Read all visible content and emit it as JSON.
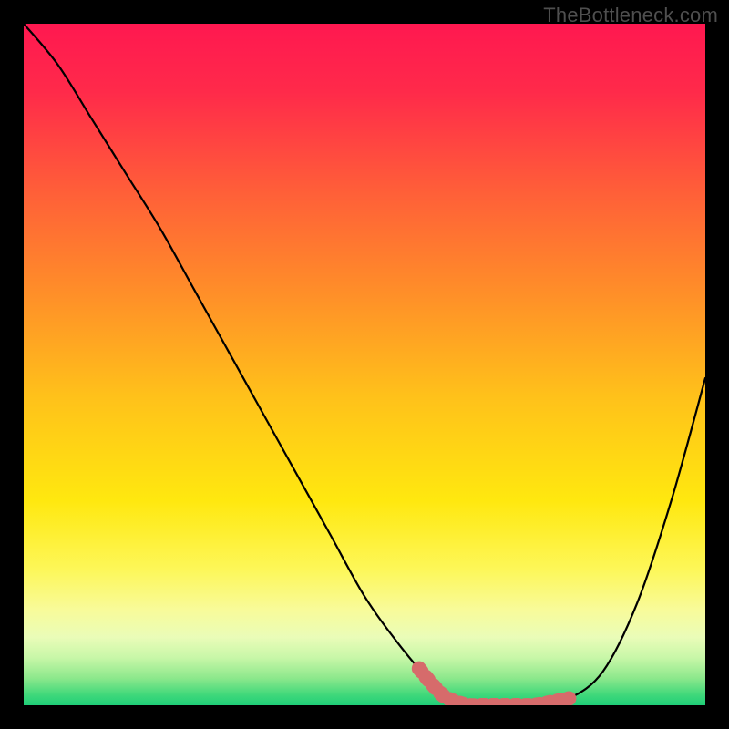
{
  "watermark": "TheBottleneck.com",
  "chart_data": {
    "type": "line",
    "title": "",
    "xlabel": "",
    "ylabel": "",
    "xlim": [
      0,
      100
    ],
    "ylim": [
      0,
      100
    ],
    "series": [
      {
        "name": "bottleneck-curve",
        "x": [
          0,
          5,
          10,
          15,
          20,
          25,
          30,
          35,
          40,
          45,
          50,
          55,
          60,
          62,
          65,
          70,
          75,
          80,
          85,
          90,
          95,
          100
        ],
        "y": [
          100,
          94,
          86,
          78,
          70,
          61,
          52,
          43,
          34,
          25,
          16,
          9,
          3,
          1,
          0,
          0,
          0,
          1,
          5,
          15,
          30,
          48
        ]
      }
    ],
    "highlight": {
      "name": "optimal-band",
      "x_range": [
        58,
        80
      ],
      "color": "#d66b6b"
    },
    "background_gradient": {
      "stops": [
        {
          "offset": 0.0,
          "color": "#ff1850"
        },
        {
          "offset": 0.1,
          "color": "#ff2a4a"
        },
        {
          "offset": 0.25,
          "color": "#ff6038"
        },
        {
          "offset": 0.4,
          "color": "#ff9028"
        },
        {
          "offset": 0.55,
          "color": "#ffc21a"
        },
        {
          "offset": 0.7,
          "color": "#ffe80f"
        },
        {
          "offset": 0.8,
          "color": "#fdf758"
        },
        {
          "offset": 0.86,
          "color": "#f8fb9a"
        },
        {
          "offset": 0.9,
          "color": "#eafcb8"
        },
        {
          "offset": 0.93,
          "color": "#c8f7a8"
        },
        {
          "offset": 0.96,
          "color": "#8de88c"
        },
        {
          "offset": 0.985,
          "color": "#3fd87a"
        },
        {
          "offset": 1.0,
          "color": "#1fce78"
        }
      ]
    }
  }
}
